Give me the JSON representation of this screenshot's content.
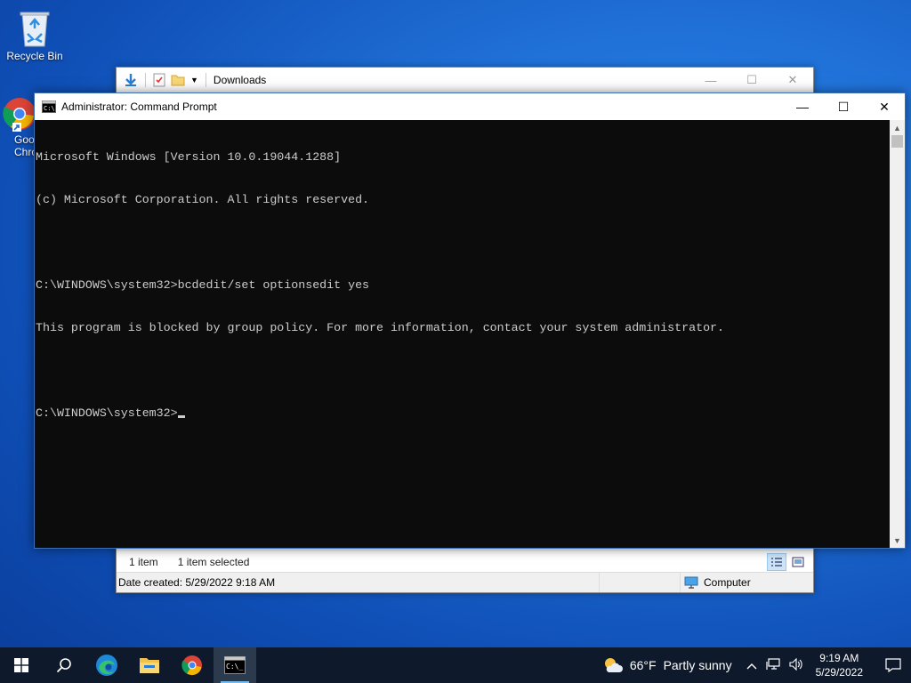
{
  "desktop": {
    "icons": [
      {
        "label": "Recycle Bin"
      },
      {
        "label": "Google Chrome"
      }
    ]
  },
  "explorer": {
    "title": "Downloads",
    "status_count": "1 item",
    "status_selected": "1 item selected",
    "details_date": "Date created: 5/29/2022 9:18 AM",
    "details_location": "Computer"
  },
  "cmd": {
    "title": "Administrator: Command Prompt",
    "lines": [
      "Microsoft Windows [Version 10.0.19044.1288]",
      "(c) Microsoft Corporation. All rights reserved.",
      "",
      "C:\\WINDOWS\\system32>bcdedit/set optionsedit yes",
      "This program is blocked by group policy. For more information, contact your system administrator.",
      "",
      "C:\\WINDOWS\\system32>"
    ]
  },
  "taskbar": {
    "weather_temp": "66°F",
    "weather_desc": "Partly sunny",
    "time": "9:19 AM",
    "date": "5/29/2022"
  }
}
